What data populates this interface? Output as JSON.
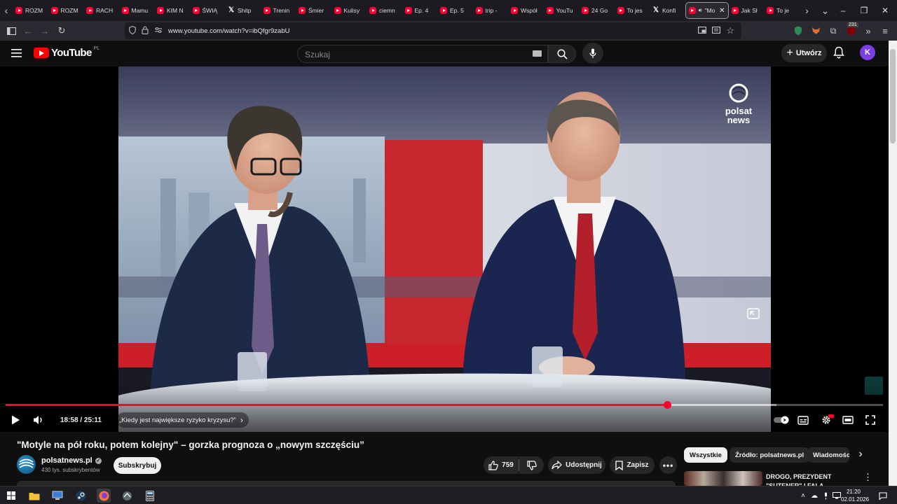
{
  "browser": {
    "tabs": [
      {
        "label": "ROZM",
        "icon": "youtube-icon"
      },
      {
        "label": "ROZM",
        "icon": "youtube-icon"
      },
      {
        "label": "RACH",
        "icon": "youtube-icon"
      },
      {
        "label": "Mamu",
        "icon": "youtube-icon"
      },
      {
        "label": "KIM N",
        "icon": "youtube-icon"
      },
      {
        "label": "ŚWIĄ",
        "icon": "youtube-icon"
      },
      {
        "label": "Shitp",
        "icon": "x-icon"
      },
      {
        "label": "Trenin",
        "icon": "youtube-icon"
      },
      {
        "label": "Śmier",
        "icon": "youtube-icon"
      },
      {
        "label": "Kulisy",
        "icon": "youtube-icon"
      },
      {
        "label": "ciemn",
        "icon": "youtube-icon"
      },
      {
        "label": "Ep. 4",
        "icon": "youtube-icon"
      },
      {
        "label": "Ep. 5",
        "icon": "youtube-icon"
      },
      {
        "label": "trip -",
        "icon": "youtube-icon"
      },
      {
        "label": "Współ",
        "icon": "youtube-icon"
      },
      {
        "label": "YouTu",
        "icon": "youtube-icon"
      },
      {
        "label": "24 Go",
        "icon": "youtube-icon"
      },
      {
        "label": "To jes",
        "icon": "youtube-icon"
      },
      {
        "label": "Konfi",
        "icon": "x-icon"
      },
      {
        "label": "\"Mo",
        "icon": "youtube-icon",
        "active": true
      },
      {
        "label": "Jak Sł",
        "icon": "youtube-icon"
      },
      {
        "label": "To je",
        "icon": "youtube-icon"
      }
    ],
    "url": "www.youtube.com/watch?v=ibQfgr9zabU",
    "extension_badge": "231"
  },
  "masthead": {
    "logo_text": "YouTube",
    "country_code": "PL",
    "search_placeholder": "Szukaj",
    "create_label": "Utwórz",
    "avatar_letter": "K"
  },
  "player": {
    "current_time": "18:58",
    "duration": "25:11",
    "time_separator": " / ",
    "progress_fraction": 0.7537,
    "chapter_title": "„Kiedy jest największe ryzyko kryzysu?”",
    "broadcaster_logo_line1": "polsat",
    "broadcaster_logo_line2": "news"
  },
  "video": {
    "title": "\"Motyle na pół roku, potem kolejny\" – gorzka prognoza o „nowym szczęściu”",
    "channel_name": "polsatnews.pl",
    "subscribers": "430 tys. subskrybentów",
    "subscribe_label": "Subskrybuj",
    "likes": "759",
    "share_label": "Udostępnij",
    "save_label": "Zapisz"
  },
  "sidebar": {
    "chips": [
      {
        "label": "Wszystkie",
        "active": true
      },
      {
        "label": "Źródło: polsatnews.pl",
        "active": false
      },
      {
        "label": "Wiadomości",
        "active": false
      }
    ],
    "recommendation_title": "DROGO, PREZYDENT \"SUTENER\" I FALA UKRAIŃCÓ..."
  },
  "taskbar": {
    "time": "21:20",
    "date": "02.01.2026"
  },
  "colors": {
    "accent_red": "#ff0033",
    "page_bg": "#0f0f0f",
    "chip_bg": "#272727"
  }
}
